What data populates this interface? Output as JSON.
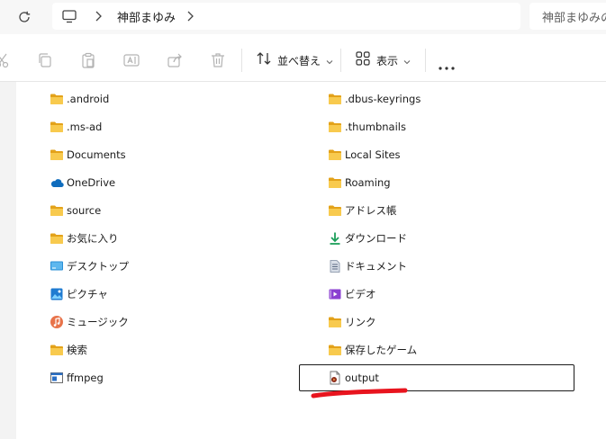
{
  "address_bar": {
    "breadcrumb": "神部まゆみ",
    "search_text": "神部まゆみの"
  },
  "toolbar": {
    "sort_label": "並べ替え",
    "view_label": "表示"
  },
  "items_left": [
    {
      "label": ".android",
      "icon": "folder-icon"
    },
    {
      "label": ".ms-ad",
      "icon": "folder-icon"
    },
    {
      "label": "Documents",
      "icon": "folder-icon"
    },
    {
      "label": "OneDrive",
      "icon": "onedrive-icon"
    },
    {
      "label": "source",
      "icon": "folder-icon"
    },
    {
      "label": "お気に入り",
      "icon": "folder-icon"
    },
    {
      "label": "デスクトップ",
      "icon": "desktop-icon"
    },
    {
      "label": "ピクチャ",
      "icon": "pictures-icon"
    },
    {
      "label": "ミュージック",
      "icon": "music-icon"
    },
    {
      "label": "検索",
      "icon": "folder-icon"
    },
    {
      "label": "ffmpeg",
      "icon": "application-icon"
    }
  ],
  "items_right": [
    {
      "label": ".dbus-keyrings",
      "icon": "folder-icon"
    },
    {
      "label": ".thumbnails",
      "icon": "folder-icon"
    },
    {
      "label": "Local Sites",
      "icon": "folder-icon"
    },
    {
      "label": "Roaming",
      "icon": "folder-icon"
    },
    {
      "label": "アドレス帳",
      "icon": "folder-icon"
    },
    {
      "label": "ダウンロード",
      "icon": "download-icon"
    },
    {
      "label": "ドキュメント",
      "icon": "documents-icon"
    },
    {
      "label": "ビデオ",
      "icon": "videos-icon"
    },
    {
      "label": "リンク",
      "icon": "folder-icon"
    },
    {
      "label": "保存したゲーム",
      "icon": "folder-icon"
    },
    {
      "label": "output",
      "icon": "media-file-icon"
    }
  ],
  "colors": {
    "folder": "#f5c242",
    "annotation_red": "#e8141e",
    "onedrive": "#0f6cbd",
    "download": "#1c9e5a"
  }
}
